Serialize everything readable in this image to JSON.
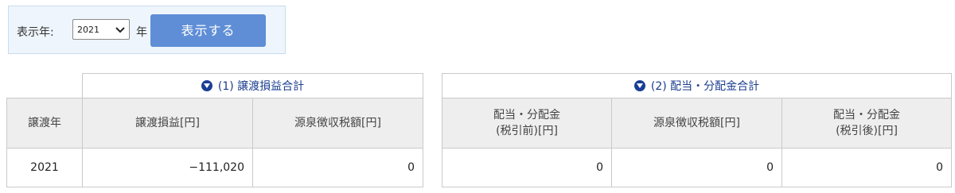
{
  "filter": {
    "label": "表示年:",
    "year_value": "2021",
    "year_suffix": "年",
    "show_button": "表示する"
  },
  "icons": {
    "select_chevron": "chevron-down-icon",
    "group_toggle": "triangle-down-circle-icon"
  },
  "colors": {
    "button": "#5f8ed6",
    "group_title": "#1a3d8f",
    "header_bg": "#eeeeee",
    "filter_bg": "#eef5fc"
  },
  "table1": {
    "group_title": "(1) 譲渡損益合計",
    "headers": [
      "譲渡年",
      "譲渡損益[円]",
      "源泉徴収税額[円]"
    ],
    "rows": [
      [
        "2021",
        "−111,020",
        "0"
      ]
    ]
  },
  "table2": {
    "group_title": "(2) 配当・分配金合計",
    "headers": [
      [
        "配当・分配金",
        "(税引前)[円]"
      ],
      [
        "源泉徴収税額[円]"
      ],
      [
        "配当・分配金",
        "(税引後)[円]"
      ]
    ],
    "rows": [
      [
        "0",
        "0",
        "0"
      ]
    ]
  }
}
